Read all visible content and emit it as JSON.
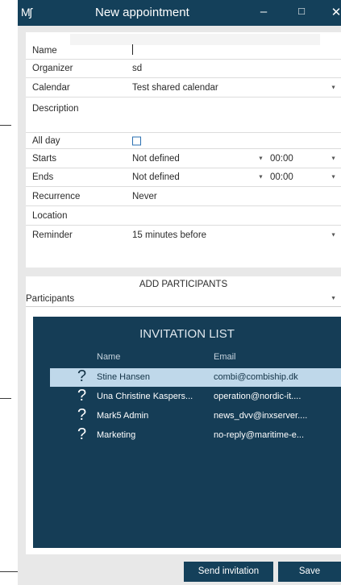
{
  "window": {
    "logo": "Mʃ",
    "title": "New appointment",
    "minimize": "–",
    "maximize": "□",
    "close": "✕"
  },
  "form": {
    "name": {
      "label": "Name",
      "value": ""
    },
    "organizer": {
      "label": "Organizer",
      "value": "sd"
    },
    "calendar": {
      "label": "Calendar",
      "value": "Test shared calendar"
    },
    "description": {
      "label": "Description",
      "value": ""
    },
    "all_day": {
      "label": "All day",
      "checked": false
    },
    "starts": {
      "label": "Starts",
      "date": "Not defined",
      "time": "00:00"
    },
    "ends": {
      "label": "Ends",
      "date": "Not defined",
      "time": "00:00"
    },
    "recurrence": {
      "label": "Recurrence",
      "value": "Never"
    },
    "location": {
      "label": "Location",
      "value": ""
    },
    "reminder": {
      "label": "Reminder",
      "value": "15 minutes before"
    }
  },
  "participants": {
    "section_title": "ADD PARTICIPANTS",
    "select_label": "Participants"
  },
  "invitation_list": {
    "title": "INVITATION LIST",
    "col_name": "Name",
    "col_email": "Email",
    "rows": [
      {
        "status_icon": "?",
        "name": "Stine Hansen",
        "email": "combi@combiship.dk",
        "selected": true
      },
      {
        "status_icon": "?",
        "name": "Una Christine Kaspers...",
        "email": "operation@nordic-it....",
        "selected": false
      },
      {
        "status_icon": "?",
        "name": "Mark5 Admin",
        "email": "news_dvv@inxserver....",
        "selected": false
      },
      {
        "status_icon": "?",
        "name": "Marketing",
        "email": "no-reply@maritime-e...",
        "selected": false
      }
    ]
  },
  "buttons": {
    "send": "Send invitation",
    "save": "Save"
  },
  "colors": {
    "titlebar": "#14405a",
    "invitation_bg": "#153d56",
    "selected_row": "#bfd8ea",
    "button": "#14405a",
    "panel_bg": "#e8e8e8"
  }
}
